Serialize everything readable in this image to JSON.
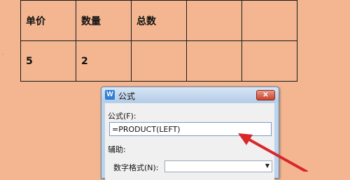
{
  "table": {
    "headers": [
      "单价",
      "数量",
      "总数",
      "",
      ""
    ],
    "rows": [
      [
        "5",
        "2",
        "",
        "",
        ""
      ]
    ]
  },
  "dialog": {
    "app_icon": "W",
    "title": "公式",
    "close_label": "✕",
    "formula_label": "公式(F):",
    "formula_value": "=PRODUCT(LEFT)",
    "helper_label": "辅助:",
    "number_format_label": "数字格式(N):",
    "number_format_value": ""
  },
  "annotation": {
    "arrow_color": "#d8262b"
  }
}
